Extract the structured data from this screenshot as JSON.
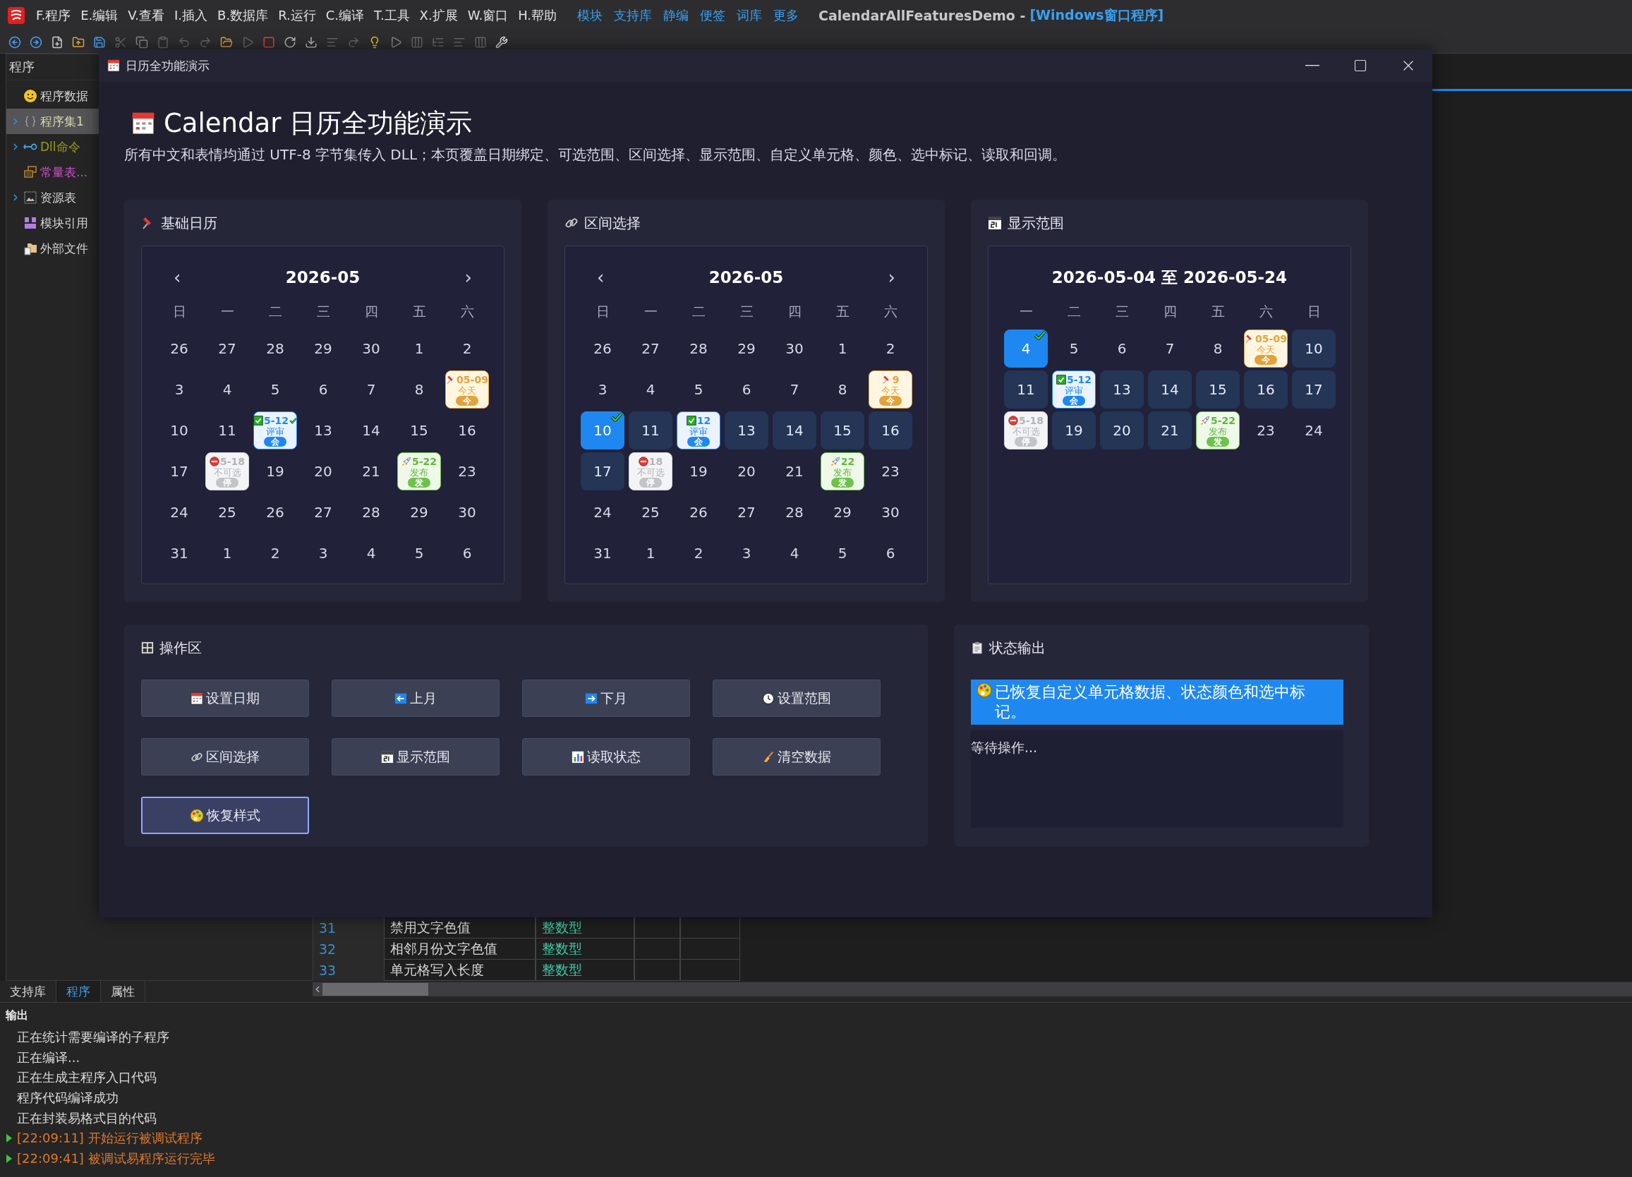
{
  "menubar": {
    "items": [
      "F.程序",
      "E.编辑",
      "V.查看",
      "I.插入",
      "B.数据库",
      "R.运行",
      "C.编译",
      "T.工具",
      "X.扩展",
      "W.窗口",
      "H.帮助"
    ],
    "links": [
      "模块",
      "支持库",
      "静编",
      "便签",
      "词库",
      "更多"
    ],
    "title": "CalendarAllFeaturesDemo -",
    "title_suffix": "[Windows窗口程序]"
  },
  "sidebar": {
    "title": "程序",
    "items": [
      {
        "label": "程序数据",
        "selected": false,
        "expandable": false,
        "color": "#d4d4d4"
      },
      {
        "label": "程序集1",
        "selected": true,
        "expandable": true,
        "color": "#d8d8a8"
      },
      {
        "label": "Dll命令",
        "selected": false,
        "expandable": true,
        "color": "#9a9a1c"
      },
      {
        "label": "常量表...",
        "selected": false,
        "expandable": false,
        "color": "#d44ed4"
      },
      {
        "label": "资源表",
        "selected": false,
        "expandable": true,
        "color": "#d4d4d4"
      },
      {
        "label": "模块引用",
        "selected": false,
        "expandable": false,
        "color": "#d4d4d4"
      },
      {
        "label": "外部文件",
        "selected": false,
        "expandable": false,
        "color": "#d4d4d4"
      }
    ]
  },
  "editor": {
    "rows": [
      {
        "line": "31",
        "name": "禁用文字色值",
        "type": "整数型"
      },
      {
        "line": "32",
        "name": "相邻月份文字色值",
        "type": "整数型"
      },
      {
        "line": "33",
        "name": "单元格写入长度",
        "type": "整数型"
      }
    ]
  },
  "bottom_tabs": [
    {
      "label": "支持库",
      "selected": false
    },
    {
      "label": "程序",
      "selected": true
    },
    {
      "label": "属性",
      "selected": false
    }
  ],
  "output": {
    "title": "输出",
    "lines": [
      {
        "kind": "info",
        "text": "正在统计需要编译的子程序"
      },
      {
        "kind": "info",
        "text": "正在编译..."
      },
      {
        "kind": "info",
        "text": "正在生成主程序入口代码"
      },
      {
        "kind": "info",
        "text": "程序代码编译成功"
      },
      {
        "kind": "info",
        "text": "正在封装易格式目的代码"
      },
      {
        "kind": "run",
        "text": "[22:09:11] 开始运行被调试程序"
      },
      {
        "kind": "run",
        "text": "[22:09:41] 被调试易程序运行完毕"
      }
    ]
  },
  "dialog": {
    "title": "日历全功能演示",
    "heading": "Calendar 日历全功能演示",
    "subtitle": "所有中文和表情均通过 UTF-8 字节集传入 DLL；本页覆盖日期绑定、可选范围、区间选择、显示范围、自定义单元格、颜色、选中标记、读取和回调。",
    "calendars": [
      {
        "title": "基础日历",
        "month": "2026-05",
        "prev": "‹",
        "next": "›",
        "weekdays": [
          "日",
          "一",
          "二",
          "三",
          "四",
          "五",
          "六"
        ],
        "weeks": [
          [
            {
              "day": "26",
              "kind": "plain",
              "marked": false
            },
            {
              "day": "27",
              "kind": "plain",
              "marked": false
            },
            {
              "day": "28",
              "kind": "plain",
              "marked": false
            },
            {
              "day": "29",
              "kind": "plain",
              "marked": false
            },
            {
              "day": "30",
              "kind": "plain",
              "marked": false
            },
            {
              "day": "1",
              "kind": "plain",
              "marked": false
            },
            {
              "day": "2",
              "kind": "plain",
              "marked": false
            }
          ],
          [
            {
              "day": "3",
              "kind": "plain",
              "marked": false
            },
            {
              "day": "4",
              "kind": "plain",
              "marked": false
            },
            {
              "day": "5",
              "kind": "plain",
              "marked": false
            },
            {
              "day": "6",
              "kind": "plain",
              "marked": false
            },
            {
              "day": "7",
              "kind": "plain",
              "marked": false
            },
            {
              "day": "8",
              "kind": "plain",
              "marked": false
            },
            {
              "day": "05-09",
              "kind": "today",
              "label": "今天",
              "badge": "今",
              "marked": false
            }
          ],
          [
            {
              "day": "10",
              "kind": "plain",
              "marked": false
            },
            {
              "day": "11",
              "kind": "plain",
              "marked": false
            },
            {
              "day": "5-12",
              "kind": "meeting",
              "label": "评审",
              "badge": "会",
              "marked": true
            },
            {
              "day": "13",
              "kind": "plain",
              "marked": false
            },
            {
              "day": "14",
              "kind": "plain",
              "marked": false
            },
            {
              "day": "15",
              "kind": "plain",
              "marked": false
            },
            {
              "day": "16",
              "kind": "plain",
              "marked": false
            }
          ],
          [
            {
              "day": "17",
              "kind": "plain",
              "marked": false
            },
            {
              "day": "5-18",
              "kind": "disabled",
              "label": "不可选",
              "badge": "停",
              "marked": false
            },
            {
              "day": "19",
              "kind": "plain",
              "marked": false
            },
            {
              "day": "20",
              "kind": "plain",
              "marked": false
            },
            {
              "day": "21",
              "kind": "plain",
              "marked": false
            },
            {
              "day": "5-22",
              "kind": "release",
              "label": "发布",
              "badge": "发",
              "marked": false
            },
            {
              "day": "23",
              "kind": "plain",
              "marked": false
            }
          ],
          [
            {
              "day": "24",
              "kind": "plain",
              "marked": false
            },
            {
              "day": "25",
              "kind": "plain",
              "marked": false
            },
            {
              "day": "26",
              "kind": "plain",
              "marked": false
            },
            {
              "day": "27",
              "kind": "plain",
              "marked": false
            },
            {
              "day": "28",
              "kind": "plain",
              "marked": false
            },
            {
              "day": "29",
              "kind": "plain",
              "marked": false
            },
            {
              "day": "30",
              "kind": "plain",
              "marked": false
            }
          ],
          [
            {
              "day": "31",
              "kind": "plain",
              "marked": false
            },
            {
              "day": "1",
              "kind": "plain",
              "marked": false
            },
            {
              "day": "2",
              "kind": "plain",
              "marked": false
            },
            {
              "day": "3",
              "kind": "plain",
              "marked": false
            },
            {
              "day": "4",
              "kind": "plain",
              "marked": false
            },
            {
              "day": "5",
              "kind": "plain",
              "marked": false
            },
            {
              "day": "6",
              "kind": "plain",
              "marked": false
            }
          ]
        ]
      },
      {
        "title": "区间选择",
        "month": "2026-05",
        "prev": "‹",
        "next": "›",
        "weekdays": [
          "日",
          "一",
          "二",
          "三",
          "四",
          "五",
          "六"
        ],
        "weeks": [
          [
            {
              "day": "26",
              "kind": "plain",
              "marked": false
            },
            {
              "day": "27",
              "kind": "plain",
              "marked": false
            },
            {
              "day": "28",
              "kind": "plain",
              "marked": false
            },
            {
              "day": "29",
              "kind": "plain",
              "marked": false
            },
            {
              "day": "30",
              "kind": "plain",
              "marked": false
            },
            {
              "day": "1",
              "kind": "plain",
              "marked": false
            },
            {
              "day": "2",
              "kind": "plain",
              "marked": false
            }
          ],
          [
            {
              "day": "3",
              "kind": "plain",
              "marked": false
            },
            {
              "day": "4",
              "kind": "plain",
              "marked": false
            },
            {
              "day": "5",
              "kind": "plain",
              "marked": false
            },
            {
              "day": "6",
              "kind": "plain",
              "marked": false
            },
            {
              "day": "7",
              "kind": "plain",
              "marked": false
            },
            {
              "day": "8",
              "kind": "plain",
              "marked": false
            },
            {
              "day": "9",
              "kind": "today",
              "label": "今天",
              "badge": "今",
              "marked": false
            }
          ],
          [
            {
              "day": "10",
              "kind": "selected",
              "marked": true
            },
            {
              "day": "11",
              "kind": "range",
              "marked": false
            },
            {
              "day": "12",
              "kind": "meeting",
              "label": "评审",
              "badge": "会",
              "marked": false
            },
            {
              "day": "13",
              "kind": "range",
              "marked": false
            },
            {
              "day": "14",
              "kind": "range",
              "marked": false
            },
            {
              "day": "15",
              "kind": "range",
              "marked": false
            },
            {
              "day": "16",
              "kind": "range",
              "marked": false
            }
          ],
          [
            {
              "day": "17",
              "kind": "range",
              "marked": false
            },
            {
              "day": "18",
              "kind": "disabled",
              "label": "不可选",
              "badge": "停",
              "marked": false
            },
            {
              "day": "19",
              "kind": "plain",
              "marked": false
            },
            {
              "day": "20",
              "kind": "plain",
              "marked": false
            },
            {
              "day": "21",
              "kind": "plain",
              "marked": false
            },
            {
              "day": "22",
              "kind": "release",
              "label": "发布",
              "badge": "发",
              "marked": false
            },
            {
              "day": "23",
              "kind": "plain",
              "marked": false
            }
          ],
          [
            {
              "day": "24",
              "kind": "plain",
              "marked": false
            },
            {
              "day": "25",
              "kind": "plain",
              "marked": false
            },
            {
              "day": "26",
              "kind": "plain",
              "marked": false
            },
            {
              "day": "27",
              "kind": "plain",
              "marked": false
            },
            {
              "day": "28",
              "kind": "plain",
              "marked": false
            },
            {
              "day": "29",
              "kind": "plain",
              "marked": false
            },
            {
              "day": "30",
              "kind": "plain",
              "marked": false
            }
          ],
          [
            {
              "day": "31",
              "kind": "plain",
              "marked": false
            },
            {
              "day": "1",
              "kind": "plain",
              "marked": false
            },
            {
              "day": "2",
              "kind": "plain",
              "marked": false
            },
            {
              "day": "3",
              "kind": "plain",
              "marked": false
            },
            {
              "day": "4",
              "kind": "plain",
              "marked": false
            },
            {
              "day": "5",
              "kind": "plain",
              "marked": false
            },
            {
              "day": "6",
              "kind": "plain",
              "marked": false
            }
          ]
        ]
      },
      {
        "title": "显示范围",
        "month": "2026-05-04 至 2026-05-24",
        "weekdays": [
          "一",
          "二",
          "三",
          "四",
          "五",
          "六",
          "日"
        ],
        "weeks": [
          [
            {
              "day": "4",
              "kind": "selected",
              "marked": true
            },
            {
              "day": "5",
              "kind": "plain",
              "marked": false
            },
            {
              "day": "6",
              "kind": "plain",
              "marked": false
            },
            {
              "day": "7",
              "kind": "plain",
              "marked": false
            },
            {
              "day": "8",
              "kind": "plain",
              "marked": false
            },
            {
              "day": "05-09",
              "kind": "today",
              "label": "今天",
              "badge": "今",
              "marked": false
            },
            {
              "day": "10",
              "kind": "range",
              "marked": false
            }
          ],
          [
            {
              "day": "11",
              "kind": "range",
              "marked": false
            },
            {
              "day": "5-12",
              "kind": "meeting",
              "label": "评审",
              "badge": "会",
              "marked": false
            },
            {
              "day": "13",
              "kind": "range",
              "marked": false
            },
            {
              "day": "14",
              "kind": "range",
              "marked": false
            },
            {
              "day": "15",
              "kind": "range",
              "marked": false
            },
            {
              "day": "16",
              "kind": "range",
              "marked": false
            },
            {
              "day": "17",
              "kind": "range",
              "marked": false
            }
          ],
          [
            {
              "day": "5-18",
              "kind": "disabled",
              "label": "不可选",
              "badge": "停",
              "marked": false
            },
            {
              "day": "19",
              "kind": "range",
              "marked": false
            },
            {
              "day": "20",
              "kind": "range",
              "marked": false
            },
            {
              "day": "21",
              "kind": "range",
              "marked": false
            },
            {
              "day": "5-22",
              "kind": "release",
              "label": "发布",
              "badge": "发",
              "marked": false
            },
            {
              "day": "23",
              "kind": "plain",
              "marked": false
            },
            {
              "day": "24",
              "kind": "plain",
              "marked": false
            }
          ]
        ]
      }
    ],
    "actions": {
      "title": "操作区",
      "buttons": [
        {
          "label": "设置日期",
          "focused": false
        },
        {
          "label": "上月",
          "focused": false
        },
        {
          "label": "下月",
          "focused": false
        },
        {
          "label": "设置范围",
          "focused": false
        },
        {
          "label": "区间选择",
          "focused": false
        },
        {
          "label": "显示范围",
          "focused": false
        },
        {
          "label": "读取状态",
          "focused": false
        },
        {
          "label": "清空数据",
          "focused": false
        },
        {
          "label": "恢复样式",
          "focused": true
        }
      ]
    },
    "status": {
      "title": "状态输出",
      "message": "已恢复自定义单元格数据、状态颜色和选中标记。",
      "log": "等待操作..."
    }
  }
}
